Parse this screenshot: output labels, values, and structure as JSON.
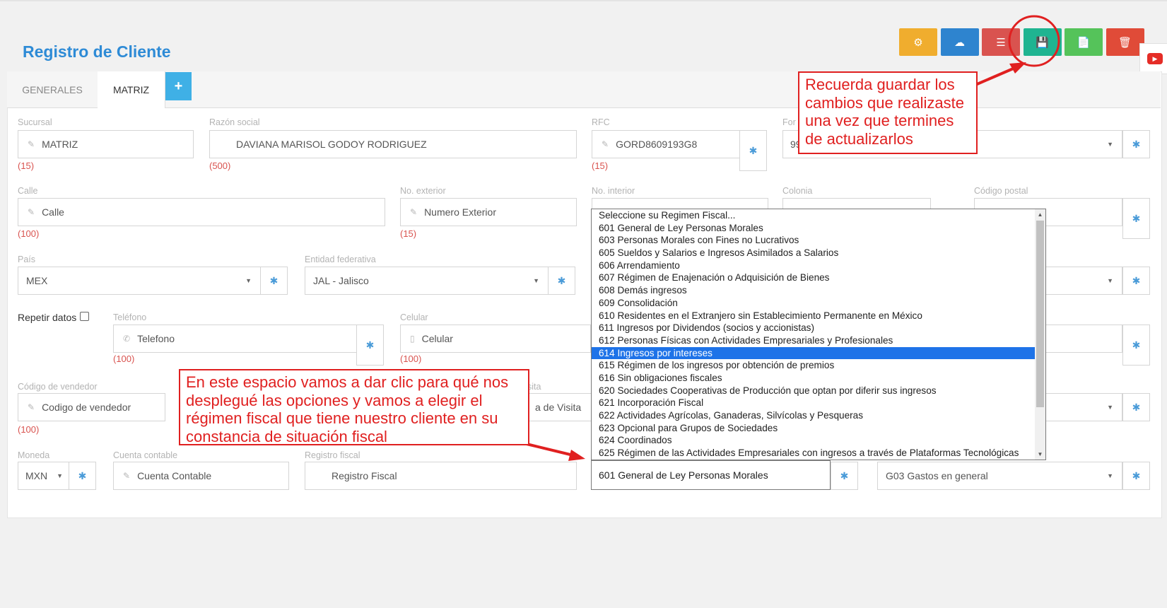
{
  "header": {
    "title": "Registro de Cliente"
  },
  "toolbar": [
    {
      "name": "share-nodes-button",
      "icon": "cogs-icon",
      "glyph": "⚙",
      "color": "#f0ad2e"
    },
    {
      "name": "cloud-upload-button",
      "icon": "cloud-upload-icon",
      "glyph": "☁",
      "color": "#2e84cf"
    },
    {
      "name": "list-button",
      "icon": "list-icon",
      "glyph": "☰",
      "color": "#d9534f"
    },
    {
      "name": "save-button",
      "icon": "save-icon",
      "glyph": "💾",
      "color": "#1fb491"
    },
    {
      "name": "new-document-button",
      "icon": "file-icon",
      "glyph": "📄",
      "color": "#55c35a"
    },
    {
      "name": "delete-button",
      "icon": "trash-icon",
      "glyph": "🗑",
      "color": "#e04b38"
    }
  ],
  "youtube": {
    "icon": "youtube-icon",
    "glyph": "▶"
  },
  "tabs": {
    "generales": "GENERALES",
    "matriz": "MATRIZ",
    "add": "+"
  },
  "form": {
    "sucursal": {
      "label": "Sucursal",
      "value": "MATRIZ",
      "count": "(15)"
    },
    "razon_social": {
      "label": "Razón social",
      "value": "DAVIANA MARISOL GODOY RODRIGUEZ",
      "count": "(500)"
    },
    "rfc": {
      "label": "RFC",
      "value": "GORD8609193G8",
      "count": "(15)"
    },
    "forma": {
      "label": "For",
      "value": "99"
    },
    "calle": {
      "label": "Calle",
      "placeholder": "Calle",
      "count": "(100)"
    },
    "no_exterior": {
      "label": "No. exterior",
      "placeholder": "Numero Exterior",
      "count": "(15)"
    },
    "no_interior": {
      "label": "No. interior"
    },
    "colonia": {
      "label": "Colonia"
    },
    "codigo_postal": {
      "label": "Código postal"
    },
    "pais": {
      "label": "País",
      "value": "MEX"
    },
    "entidad": {
      "label": "Entidad federativa",
      "value": "JAL - Jalisco"
    },
    "repetir": {
      "label": "Repetir datos"
    },
    "telefono": {
      "label": "Teléfono",
      "placeholder": "Telefono",
      "count": "(100)"
    },
    "celular": {
      "label": "Celular",
      "placeholder": "Celular",
      "count": "(100)"
    },
    "hidden_right_text": "a",
    "vendedor": {
      "label": "Código de vendedor",
      "placeholder": "Codigo de vendedor",
      "count": "(100)"
    },
    "visita": {
      "label": "sita",
      "placeholder": "a de Visita"
    },
    "moneda": {
      "label": "Moneda",
      "value": "MXN"
    },
    "cuenta": {
      "label": "Cuenta contable",
      "placeholder": "Cuenta Contable"
    },
    "registro": {
      "label": "Registro fiscal",
      "placeholder": "Registro Fiscal"
    },
    "regimen": {
      "value": "601 General de Ley Personas Morales"
    },
    "uso_cfdi": {
      "value": "G03 Gastos en general"
    }
  },
  "dropdown": {
    "selected_index": 11,
    "options": [
      "Seleccione su Regimen Fiscal...",
      "601 General de Ley Personas Morales",
      "603 Personas Morales con Fines no Lucrativos",
      "605 Sueldos y Salarios e Ingresos Asimilados a Salarios",
      "606 Arrendamiento",
      "607 Régimen de Enajenación o Adquisición de Bienes",
      "608 Demás ingresos",
      "609 Consolidación",
      "610 Residentes en el Extranjero sin Establecimiento Permanente en México",
      "611 Ingresos por Dividendos (socios y accionistas)",
      "612 Personas Físicas con Actividades Empresariales y Profesionales",
      "614 Ingresos por intereses",
      "615 Régimen de los ingresos por obtención de premios",
      "616 Sin obligaciones fiscales",
      "620 Sociedades Cooperativas de Producción que optan por diferir sus ingresos",
      "621 Incorporación Fiscal",
      "622 Actividades Agrícolas, Ganaderas, Silvícolas y Pesqueras",
      "623 Opcional para Grupos de Sociedades",
      "624 Coordinados",
      "625 Régimen de las Actividades Empresariales con ingresos a través de Plataformas Tecnológicas"
    ]
  },
  "annotations": {
    "save_note": "Recuerda guardar los cambios que realizaste una vez que termines de actualizarlos",
    "select_note": "En este espacio vamos a dar clic para qué nos desplegué las opciones y vamos a elegir el régimen fiscal que tiene nuestro cliente en su constancia de situación fiscal",
    "color": "#e02020"
  }
}
